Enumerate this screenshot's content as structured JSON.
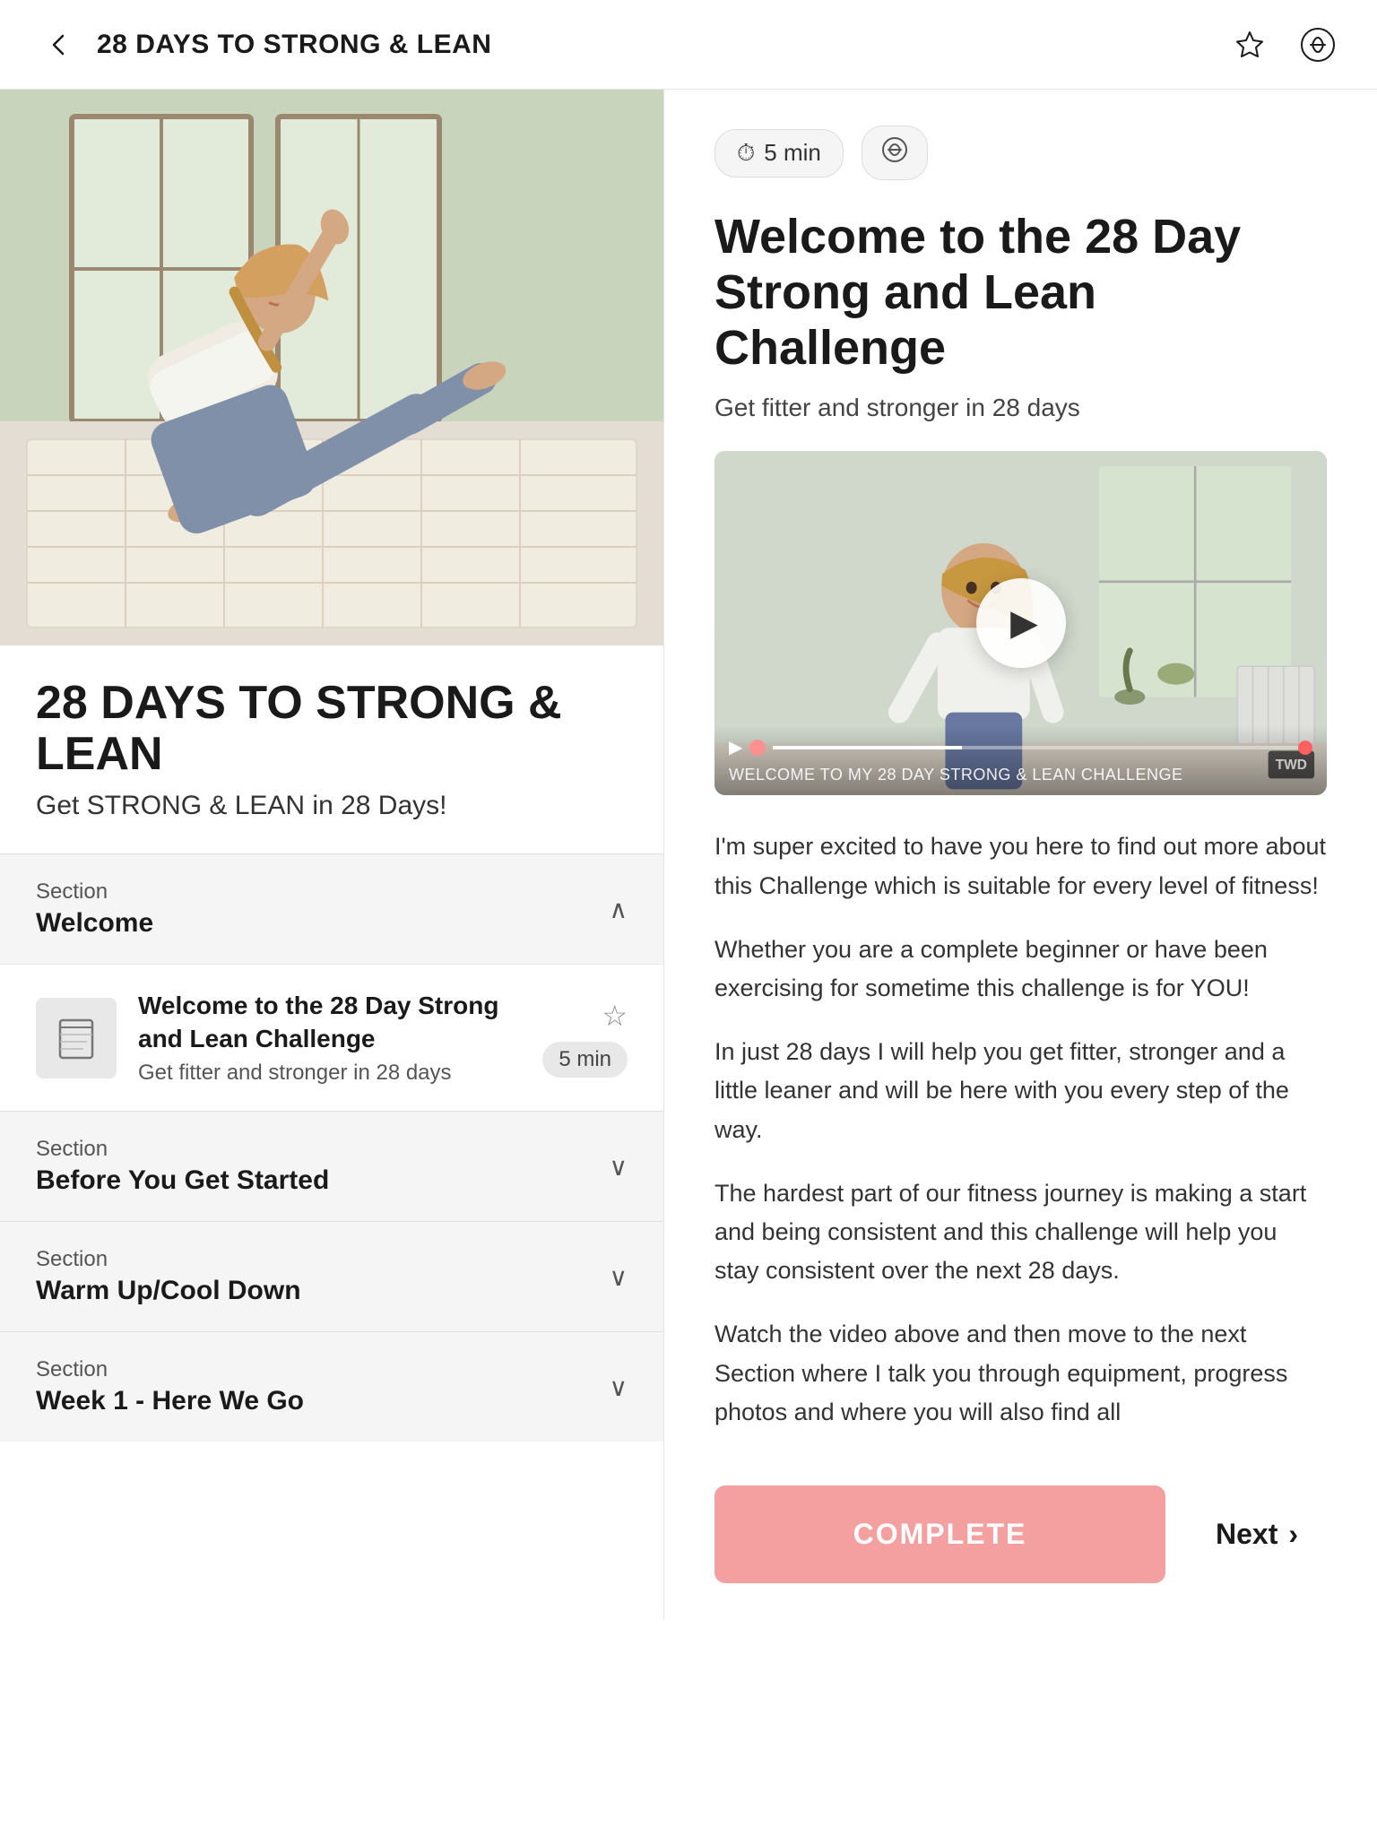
{
  "header": {
    "back_label": "‹",
    "title": "28 DAYS TO STRONG & LEAN",
    "bookmark_icon": "☆",
    "link_icon": "⚇"
  },
  "hero": {
    "alt": "Fitness person doing side plank"
  },
  "course": {
    "title": "28 DAYS TO STRONG & LEAN",
    "subtitle": "Get STRONG & LEAN in 28 Days!"
  },
  "sections": [
    {
      "id": "welcome",
      "label": "Section",
      "name": "Welcome",
      "expanded": true,
      "chevron": "∧"
    },
    {
      "id": "before-you-get-started",
      "label": "Section",
      "name": "Before You Get Started",
      "expanded": false,
      "chevron": "∨"
    },
    {
      "id": "warm-up-cool-down",
      "label": "Section",
      "name": "Warm Up/Cool Down",
      "expanded": false,
      "chevron": "∨"
    },
    {
      "id": "week-1-here-we-go",
      "label": "Section",
      "name": "Week 1 - Here We Go",
      "expanded": false,
      "chevron": "∨"
    }
  ],
  "lesson": {
    "icon": "⊟",
    "title": "Welcome to the 28 Day Strong and Lean Challenge",
    "description": "Get fitter and stronger in 28 days",
    "duration": "5 min",
    "star_icon": "☆"
  },
  "content": {
    "meta_time": "5 min",
    "meta_time_icon": "⏱",
    "meta_link_icon": "⚇",
    "title": "Welcome to the 28 Day Strong and Lean Challenge",
    "subtitle": "Get fitter and stronger in 28 days",
    "video_label": "TWD",
    "video_bottom_text": "WELCOME TO MY 28 DAY STRONG & LEAN CHALLENGE",
    "body_paragraphs": [
      "I'm super excited to have you here to find out more about this Challenge which is suitable for every level of fitness!",
      "Whether you are a complete beginner or have been exercising for sometime this challenge is for YOU!",
      "In just 28 days I will help you get fitter, stronger and a little leaner and will be here with you every step of the way.",
      "The hardest part of our fitness journey is making a start and being consistent and this challenge will help you stay consistent over the next 28 days.",
      "Watch the video above and then move to the next Section where I talk you through equipment, progress photos and where you will also find all"
    ],
    "complete_label": "COMPLETE",
    "next_label": "Next",
    "next_chevron": "›"
  }
}
